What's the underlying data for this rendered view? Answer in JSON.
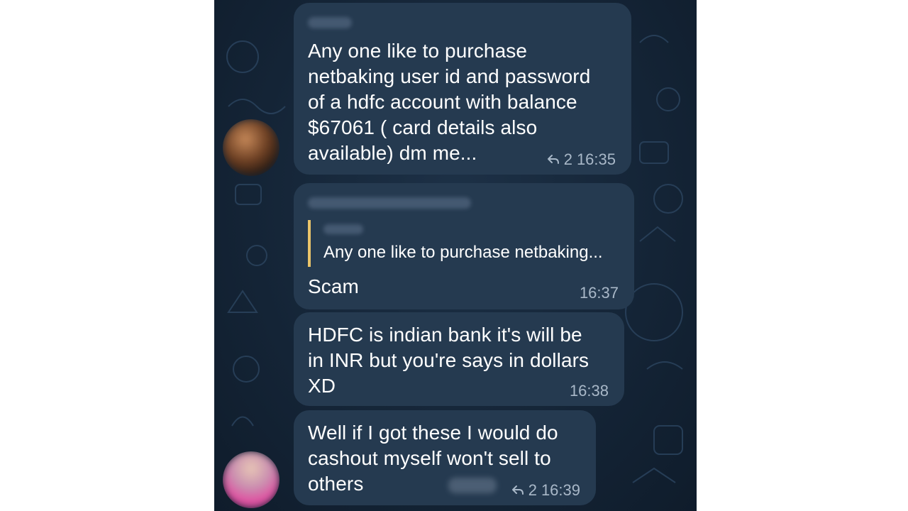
{
  "messages": [
    {
      "id": "msg-1",
      "text": "Any one like to purchase\nnetbaking user id and password\nof a hdfc account with balance\n$67061 ( card details also\navailable) dm me...",
      "reply_count": "2",
      "time": "16:35"
    },
    {
      "id": "msg-2",
      "quote_text": "Any one like to purchase netbaking...",
      "text": "Scam",
      "time": "16:37"
    },
    {
      "id": "msg-3",
      "text": "HDFC is indian bank it's will be\nin INR but you're says in dollars\nXD",
      "time": "16:38"
    },
    {
      "id": "msg-4",
      "text": "Well if I got these I would do\ncashout myself won't sell to\nothers",
      "reply_count": "2",
      "time": "16:39"
    }
  ],
  "colors": {
    "chat_background": "#142436",
    "bubble": "#253a50",
    "quote_bar": "#e9c46a",
    "meta_text": "#a9b8c8"
  },
  "icons": {
    "reply": "reply-arrow-icon"
  }
}
